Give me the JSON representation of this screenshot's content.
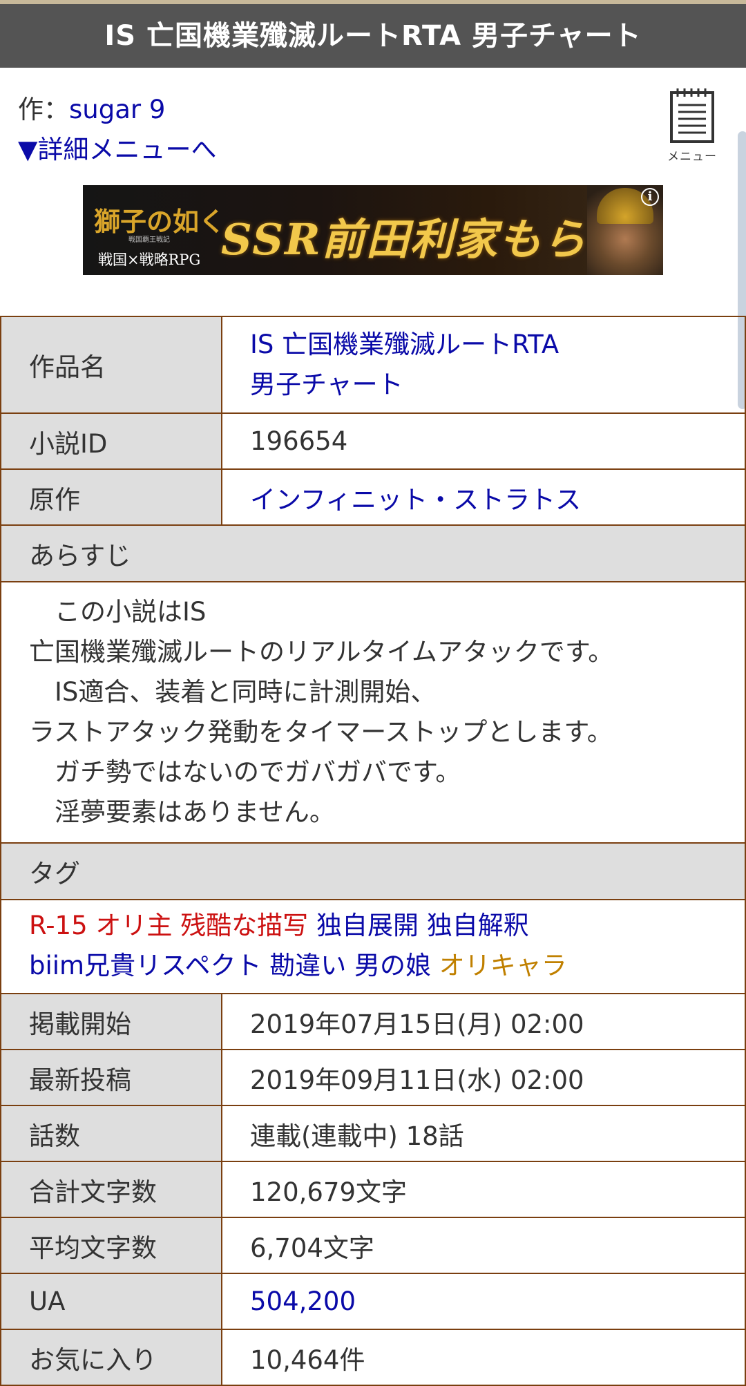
{
  "header": {
    "title": "IS 亡国機業殲滅ルートRTA 男子チャート"
  },
  "author": {
    "prefix": "作：",
    "name": "sugar 9"
  },
  "detail_menu_link": "▼詳細メニューへ",
  "menu_button": {
    "label": "メニュー"
  },
  "ad": {
    "logo_main": "獅子の如く",
    "logo_sub": "戦国覇王戦記",
    "logo_genre": "戦国×戦略RPG",
    "headline": "SSR前田利家もらえる",
    "info": "i"
  },
  "info": {
    "title_label": "作品名",
    "title_line1": "IS 亡国機業殲滅ルートRTA",
    "title_line2": "男子チャート",
    "id_label": "小説ID",
    "id_value": "196654",
    "original_label": "原作",
    "original_value": "インフィニット・ストラトス",
    "synopsis_label": "あらすじ",
    "synopsis_lines": [
      "　この小説はIS",
      "亡国機業殲滅ルートのリアルタイムアタックです。",
      "　IS適合、装着と同時に計測開始、",
      "ラストアタック発動をタイマーストップとします。",
      "　ガチ勢ではないのでガバガバです。",
      "　淫夢要素はありません。"
    ],
    "tags_label": "タグ",
    "tags": {
      "r15": "R-15",
      "orishu": "オリ主",
      "zankoku": "残酷な描写",
      "dokuji_tenkai": "独自展開",
      "dokuji_kaishaku": "独自解釈",
      "biim": "biim兄貴リスペクト",
      "kanchigai": "勘違い",
      "otokonoko": "男の娘",
      "orichara": "オリキャラ"
    },
    "start_label": "掲載開始",
    "start_value": "2019年07月15日(月) 02:00",
    "latest_label": "最新投稿",
    "latest_value": "2019年09月11日(水) 02:00",
    "episodes_label": "話数",
    "episodes_value": "連載(連載中) 18話",
    "total_chars_label": "合計文字数",
    "total_chars_value": "120,679文字",
    "avg_chars_label": "平均文字数",
    "avg_chars_value": "6,704文字",
    "ua_label": "UA",
    "ua_value": "504,200",
    "fav_label": "お気に入り",
    "fav_value": "10,464件"
  },
  "colors": {
    "header_bg": "#545454",
    "link": "#0a0aa8",
    "tag_red": "#cc1111",
    "tag_orange": "#c08000",
    "table_border": "#7a3f10",
    "label_bg": "#dedede"
  }
}
